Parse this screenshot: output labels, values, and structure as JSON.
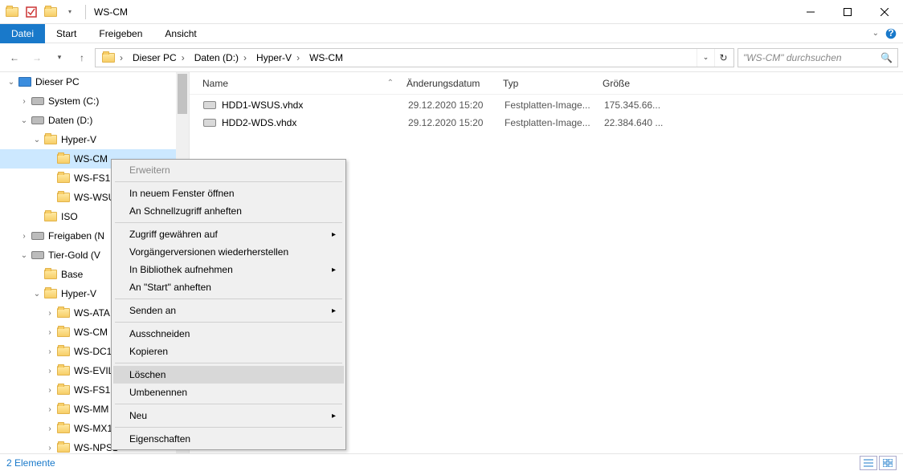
{
  "window": {
    "title": "WS-CM"
  },
  "ribbon": {
    "tabs": [
      "Datei",
      "Start",
      "Freigeben",
      "Ansicht"
    ],
    "active": 0
  },
  "breadcrumbs": [
    "Dieser PC",
    "Daten (D:)",
    "Hyper-V",
    "WS-CM"
  ],
  "search": {
    "placeholder": "\"WS-CM\" durchsuchen"
  },
  "columns": {
    "name": "Name",
    "date": "Änderungsdatum",
    "type": "Typ",
    "size": "Größe"
  },
  "files": [
    {
      "name": "HDD1-WSUS.vhdx",
      "date": "29.12.2020 15:20",
      "type": "Festplatten-Image...",
      "size": "175.345.66..."
    },
    {
      "name": "HDD2-WDS.vhdx",
      "date": "29.12.2020 15:20",
      "type": "Festplatten-Image...",
      "size": "22.384.640 ..."
    }
  ],
  "tree": [
    {
      "ind": 0,
      "exp": "v",
      "icon": "pc",
      "label": "Dieser PC"
    },
    {
      "ind": 1,
      "exp": ">",
      "icon": "drive",
      "label": "System (C:)"
    },
    {
      "ind": 1,
      "exp": "v",
      "icon": "drive",
      "label": "Daten (D:)"
    },
    {
      "ind": 2,
      "exp": "v",
      "icon": "folder",
      "label": "Hyper-V"
    },
    {
      "ind": 3,
      "exp": "",
      "icon": "folder",
      "label": "WS-CM",
      "selected": true
    },
    {
      "ind": 3,
      "exp": "",
      "icon": "folder",
      "label": "WS-FS1"
    },
    {
      "ind": 3,
      "exp": "",
      "icon": "folder",
      "label": "WS-WSU"
    },
    {
      "ind": 2,
      "exp": "",
      "icon": "folder",
      "label": "ISO"
    },
    {
      "ind": 1,
      "exp": ">",
      "icon": "net",
      "label": "Freigaben (N"
    },
    {
      "ind": 1,
      "exp": "v",
      "icon": "drive",
      "label": "Tier-Gold (V"
    },
    {
      "ind": 2,
      "exp": "",
      "icon": "folder",
      "label": "Base"
    },
    {
      "ind": 2,
      "exp": "v",
      "icon": "folder",
      "label": "Hyper-V"
    },
    {
      "ind": 3,
      "exp": ">",
      "icon": "folder",
      "label": "WS-ATA"
    },
    {
      "ind": 3,
      "exp": ">",
      "icon": "folder",
      "label": "WS-CM"
    },
    {
      "ind": 3,
      "exp": ">",
      "icon": "folder",
      "label": "WS-DC1"
    },
    {
      "ind": 3,
      "exp": ">",
      "icon": "folder",
      "label": "WS-EVIL1"
    },
    {
      "ind": 3,
      "exp": ">",
      "icon": "folder",
      "label": "WS-FS1"
    },
    {
      "ind": 3,
      "exp": ">",
      "icon": "folder",
      "label": "WS-MM"
    },
    {
      "ind": 3,
      "exp": ">",
      "icon": "folder",
      "label": "WS-MX1"
    },
    {
      "ind": 3,
      "exp": ">",
      "icon": "folder",
      "label": "WS-NPS1"
    }
  ],
  "ctx": {
    "items": [
      {
        "label": "Erweitern",
        "disabled": true
      },
      {
        "sep": true
      },
      {
        "label": "In neuem Fenster öffnen"
      },
      {
        "label": "An Schnellzugriff anheften"
      },
      {
        "sep": true
      },
      {
        "label": "Zugriff gewähren auf",
        "sub": true
      },
      {
        "label": "Vorgängerversionen wiederherstellen"
      },
      {
        "label": "In Bibliothek aufnehmen",
        "sub": true
      },
      {
        "label": "An \"Start\" anheften"
      },
      {
        "sep": true
      },
      {
        "label": "Senden an",
        "sub": true
      },
      {
        "sep": true
      },
      {
        "label": "Ausschneiden"
      },
      {
        "label": "Kopieren"
      },
      {
        "sep": true
      },
      {
        "label": "Löschen",
        "hover": true
      },
      {
        "label": "Umbenennen"
      },
      {
        "sep": true
      },
      {
        "label": "Neu",
        "sub": true
      },
      {
        "sep": true
      },
      {
        "label": "Eigenschaften"
      }
    ]
  },
  "status": {
    "text": "2 Elemente"
  }
}
